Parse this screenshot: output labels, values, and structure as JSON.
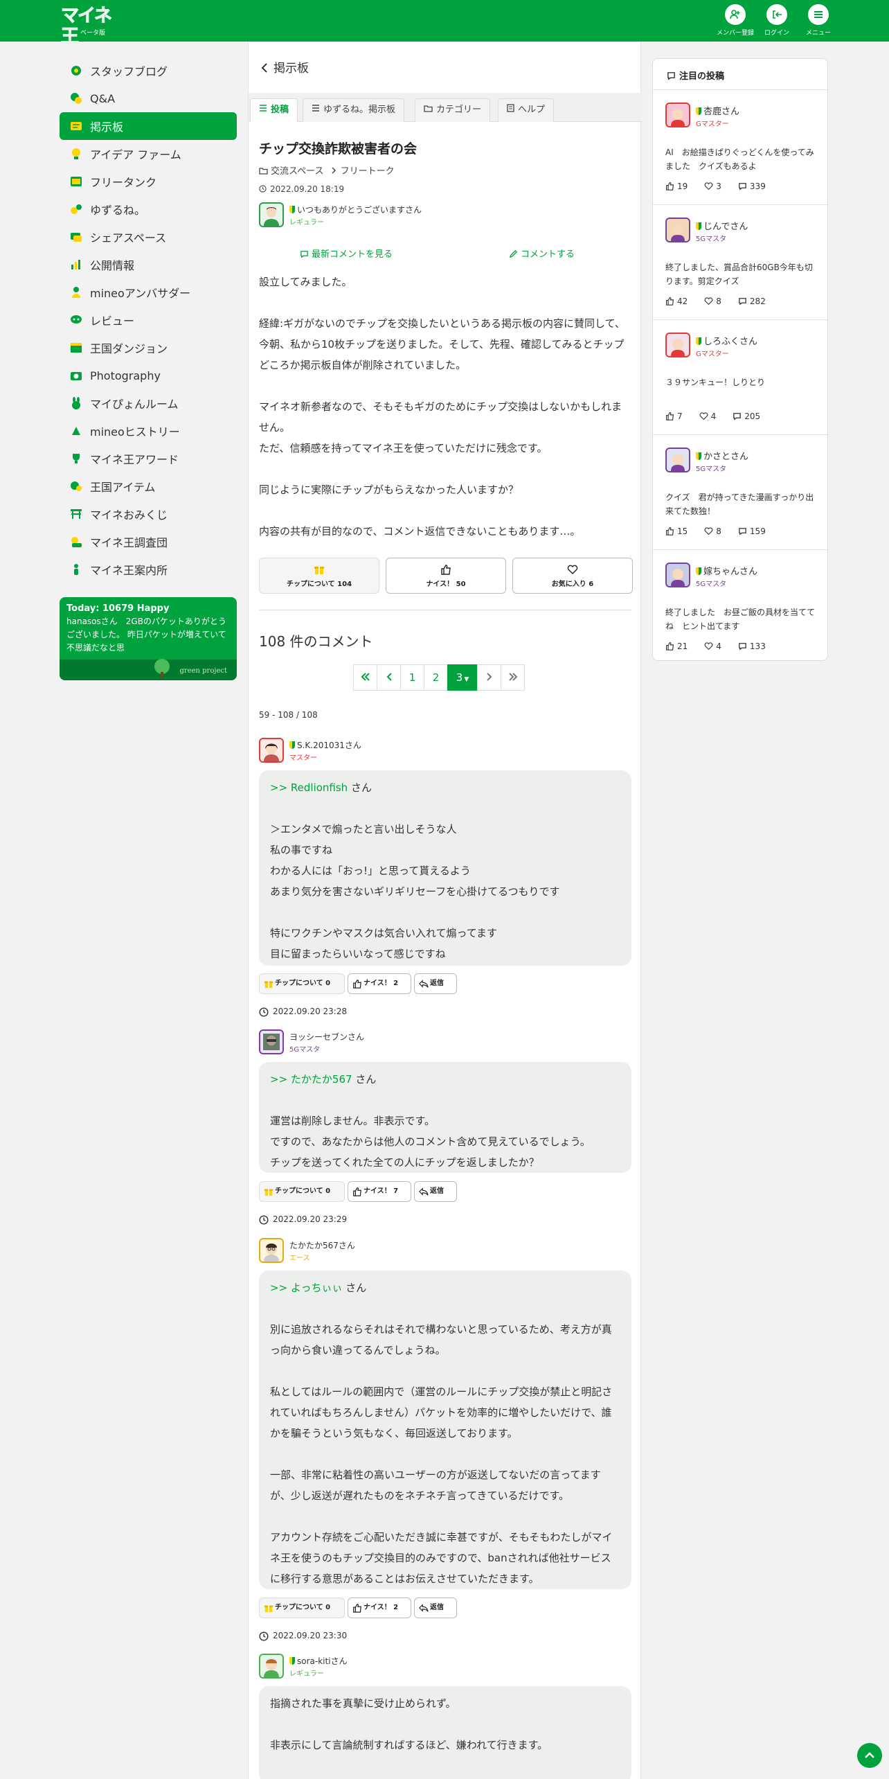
{
  "header": {
    "logo_text": "マイネ王",
    "logo_sub": "ベータ版",
    "buttons": [
      {
        "label": "メンバー登録",
        "icon": "add-user-icon"
      },
      {
        "label": "ログイン",
        "icon": "login-icon"
      },
      {
        "label": "メニュー",
        "icon": "menu-icon"
      }
    ]
  },
  "sidebar": {
    "items": [
      {
        "label": "スタッフブログ",
        "icon": "staff-blog-icon"
      },
      {
        "label": "Q&A",
        "icon": "qa-icon"
      },
      {
        "label": "掲示板",
        "icon": "board-icon",
        "active": true
      },
      {
        "label": "アイデア ファーム",
        "icon": "idea-farm-icon"
      },
      {
        "label": "フリータンク",
        "icon": "free-tank-icon"
      },
      {
        "label": "ゆずるね。",
        "icon": "yuzurune-icon"
      },
      {
        "label": "シェアスペース",
        "icon": "share-space-icon"
      },
      {
        "label": "公開情報",
        "icon": "public-info-icon"
      },
      {
        "label": "mineoアンバサダー",
        "icon": "ambassador-icon"
      },
      {
        "label": "レビュー",
        "icon": "review-icon"
      },
      {
        "label": "王国ダンジョン",
        "icon": "dungeon-icon"
      },
      {
        "label": "Photography",
        "icon": "camera-icon"
      },
      {
        "label": "マイぴょんルーム",
        "icon": "mypyon-room-icon"
      },
      {
        "label": "mineoヒストリー",
        "icon": "history-icon"
      },
      {
        "label": "マイネ王アワード",
        "icon": "award-icon"
      },
      {
        "label": "王国アイテム",
        "icon": "item-icon"
      },
      {
        "label": "マイネおみくじ",
        "icon": "omikuji-icon"
      },
      {
        "label": "マイネ王調査団",
        "icon": "research-icon"
      },
      {
        "label": "マイネ王案内所",
        "icon": "guide-icon"
      }
    ],
    "today": {
      "title": "Today: 10679 Happy",
      "text": "hanasosさん　2GBのパケットありがとうございました。 昨日パケットが増えていて不思議だなと思",
      "brand": "green project"
    }
  },
  "main": {
    "back_label": "掲示板",
    "tabs": [
      {
        "label": "投稿",
        "active": true
      },
      {
        "label": "ゆずるね。掲示板"
      },
      {
        "label": "カテゴリー"
      },
      {
        "label": "ヘルプ"
      }
    ],
    "post": {
      "title": "チップ交換詐欺被害者の会",
      "breadcrumb": [
        "交流スペース",
        "フリートーク"
      ],
      "date": "2022.09.20 18:19",
      "author": "いつもありがとうございますさん",
      "author_rank": "レギュラー",
      "see_latest": "最新コメントを見る",
      "comment_action": "コメントする",
      "body": [
        "設立してみました。",
        "",
        "経緯:ギガがないのでチップを交換したいというある掲示板の内容に賛同して、今朝、私から10枚チップを送りました。そして、先程、確認してみるとチップどころか掲示板自体が削除されていました。",
        "",
        "マイネオ新参者なので、そもそもギガのためにチップ交換はしないかもしれません。",
        "ただ、信頼感を持ってマイネ王を使っていただけに残念です。",
        "",
        "同じように実際にチップがもらえなかった人いますか？",
        "",
        "内容の共有が目的なので、コメント返信できないこともあります…。"
      ],
      "chip_btn": "チップについて 104",
      "nice_btn": "ナイス！ 50",
      "fav_btn": "お気に入り 6"
    },
    "comment_count": "108 件のコメント",
    "pagination": {
      "pages": [
        "1",
        "2"
      ],
      "current": "3"
    },
    "page_range": "59 - 108 / 108",
    "comments": [
      {
        "author": "S.K.201031さん",
        "rank": "マスター",
        "reply_to": ">> Redlionfish",
        "reply_suffix": " さん",
        "lines": [
          "",
          "＞エンタメで煽ったと言い出しそうな人",
          "私の事ですね",
          "わかる人には「おっ!」と思って貰えるよう",
          "あまり気分を害さないギリギリセーフを心掛けてるつもりです",
          "",
          "特にワクチンやマスクは気合い入れて煽ってます",
          "目に留まったらいいなって感じですね"
        ],
        "chip": "チップについて 0",
        "nice": "ナイス！ 2",
        "reply": "返信",
        "date": "2022.09.20 23:28"
      },
      {
        "author": "ヨッシーセブンさん",
        "rank": "5Gマスタ",
        "reply_to": ">> たかたか567",
        "reply_suffix": " さん",
        "lines": [
          "",
          "運営は削除しません。非表示です。",
          "ですので、あなたからは他人のコメント含めて見えているでしょう。",
          "チップを送ってくれた全ての人にチップを返しましたか？"
        ],
        "chip": "チップについて 0",
        "nice": "ナイス！ 7",
        "reply": "返信",
        "date": "2022.09.20 23:29"
      },
      {
        "author": "たかたか567さん",
        "rank": "エース",
        "reply_to": ">> よっちぃぃ",
        "reply_suffix": " さん",
        "lines": [
          "",
          "別に追放されるならそれはそれで構わないと思っているため、考え方が真っ向から食い違ってるんでしょうね。",
          "",
          "私としてはルールの範囲内で（運営のルールにチップ交換が禁止と明記されていればもちろんしません）パケットを効率的に増やしたいだけで、誰かを騙そうという気もなく、毎回返送しております。",
          "",
          "一部、非常に粘着性の高いユーザーの方が返送してないだの言ってますが、少し返送が遅れたものをネチネチ言ってきているだけです。",
          "",
          "アカウント存続をご心配いただき誠に幸甚ですが、そもそもわたしがマイネ王を使うのもチップ交換目的のみですので、banされれば他社サービスに移行する意思があることはお伝えさせていただきます。"
        ],
        "chip": "チップについて 0",
        "nice": "ナイス！ 2",
        "reply": "返信",
        "date": "2022.09.20 23:30"
      },
      {
        "author": "sora-kitiさん",
        "rank": "レギュラー",
        "lines": [
          "指摘された事を真摯に受け止められず。",
          "",
          "非表示にして言論統制すればするほど、嫌われて行きます。"
        ]
      }
    ]
  },
  "right": {
    "heading": "注目の投稿",
    "posts": [
      {
        "name": "杏鹿さん",
        "rank": "Gマスター",
        "text": "AI　お絵描きぱりぐっどくんを使ってみました　クイズもあるよ",
        "nice": "19",
        "fav": "3",
        "comments": "339"
      },
      {
        "name": "じんでさん",
        "rank": "5Gマスタ",
        "text": "終了しました、賞品合計60GB今年も切ります。剪定クイズ",
        "nice": "42",
        "fav": "8",
        "comments": "282"
      },
      {
        "name": "しろふくさん",
        "rank": "Gマスター",
        "text": "３９サンキュー！しりとり",
        "nice": "7",
        "fav": "4",
        "comments": "205"
      },
      {
        "name": "かさとさん",
        "rank": "5Gマスタ",
        "text": "クイズ　君が持ってきた漫画すっかり出来てた数独！",
        "nice": "15",
        "fav": "8",
        "comments": "159"
      },
      {
        "name": "嫁ちゃんさん",
        "rank": "5Gマスタ",
        "text": "終了しました　お昼ご飯の具材を当ててね　ヒント出てます",
        "nice": "21",
        "fav": "4",
        "comments": "133"
      }
    ]
  },
  "colors": {
    "brand": "#00a23e",
    "master": "#e53935",
    "fiveg": "#7b3fa0",
    "regular": "#4caf50",
    "ace": "#e6a817"
  }
}
